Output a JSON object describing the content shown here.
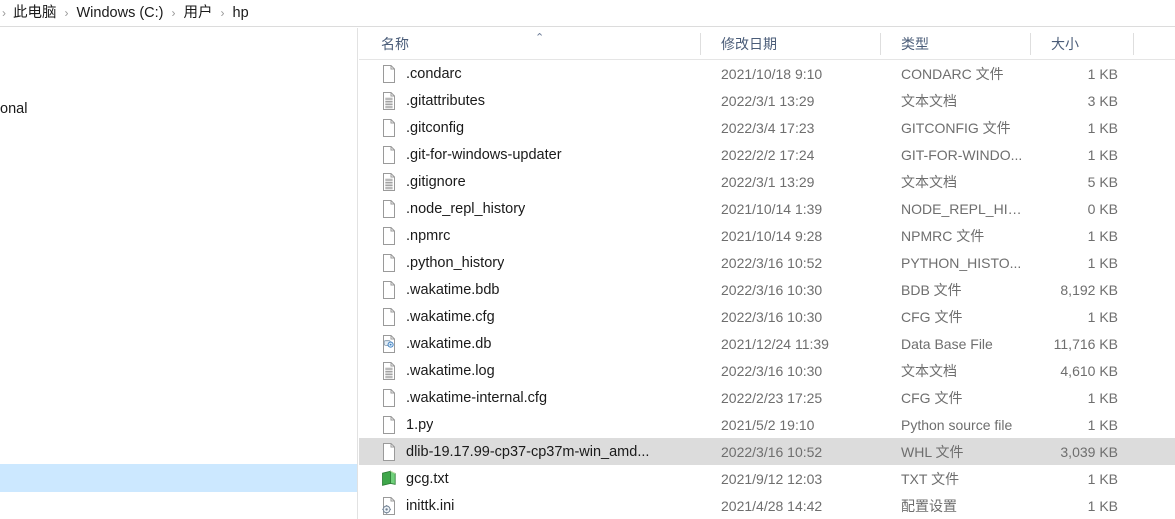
{
  "breadcrumb": {
    "items": [
      "此电脑",
      "Windows (C:)",
      "用户",
      "hp"
    ],
    "separator": "›"
  },
  "nav_pane": {
    "clipped_label": "onal",
    "selected_item_label": ""
  },
  "file_list": {
    "columns": {
      "name": "名称",
      "date": "修改日期",
      "type": "类型",
      "size": "大小"
    },
    "sort_indicator": "⌃",
    "rows": [
      {
        "icon": "blank-file-icon",
        "name": ".condarc",
        "date": "2021/10/18 9:10",
        "type": "CONDARC 文件",
        "size": "1 KB",
        "selected": false
      },
      {
        "icon": "text-file-icon",
        "name": ".gitattributes",
        "date": "2022/3/1 13:29",
        "type": "文本文档",
        "size": "3 KB",
        "selected": false
      },
      {
        "icon": "blank-file-icon",
        "name": ".gitconfig",
        "date": "2022/3/4 17:23",
        "type": "GITCONFIG 文件",
        "size": "1 KB",
        "selected": false
      },
      {
        "icon": "blank-file-icon",
        "name": ".git-for-windows-updater",
        "date": "2022/2/2 17:24",
        "type": "GIT-FOR-WINDO...",
        "size": "1 KB",
        "selected": false
      },
      {
        "icon": "text-file-icon",
        "name": ".gitignore",
        "date": "2022/3/1 13:29",
        "type": "文本文档",
        "size": "5 KB",
        "selected": false
      },
      {
        "icon": "blank-file-icon",
        "name": ".node_repl_history",
        "date": "2021/10/14 1:39",
        "type": "NODE_REPL_HIS...",
        "size": "0 KB",
        "selected": false
      },
      {
        "icon": "blank-file-icon",
        "name": ".npmrc",
        "date": "2021/10/14 9:28",
        "type": "NPMRC 文件",
        "size": "1 KB",
        "selected": false
      },
      {
        "icon": "blank-file-icon",
        "name": ".python_history",
        "date": "2022/3/16 10:52",
        "type": "PYTHON_HISTO...",
        "size": "1 KB",
        "selected": false
      },
      {
        "icon": "blank-file-icon",
        "name": ".wakatime.bdb",
        "date": "2022/3/16 10:30",
        "type": "BDB 文件",
        "size": "8,192 KB",
        "selected": false
      },
      {
        "icon": "blank-file-icon",
        "name": ".wakatime.cfg",
        "date": "2022/3/16 10:30",
        "type": "CFG 文件",
        "size": "1 KB",
        "selected": false
      },
      {
        "icon": "database-file-icon",
        "name": ".wakatime.db",
        "date": "2021/12/24 11:39",
        "type": "Data Base File",
        "size": "11,716 KB",
        "selected": false
      },
      {
        "icon": "text-file-icon",
        "name": ".wakatime.log",
        "date": "2022/3/16 10:30",
        "type": "文本文档",
        "size": "4,610 KB",
        "selected": false
      },
      {
        "icon": "blank-file-icon",
        "name": ".wakatime-internal.cfg",
        "date": "2022/2/23 17:25",
        "type": "CFG 文件",
        "size": "1 KB",
        "selected": false
      },
      {
        "icon": "blank-file-icon",
        "name": "1.py",
        "date": "2021/5/2 19:10",
        "type": "Python source file",
        "size": "1 KB",
        "selected": false
      },
      {
        "icon": "blank-file-icon",
        "name": "dlib-19.17.99-cp37-cp37m-win_amd...",
        "date": "2022/3/16 10:52",
        "type": "WHL 文件",
        "size": "3,039 KB",
        "selected": true
      },
      {
        "icon": "green-book-icon",
        "name": "gcg.txt",
        "date": "2021/9/12 12:03",
        "type": "TXT 文件",
        "size": "1 KB",
        "selected": false
      },
      {
        "icon": "config-file-icon",
        "name": "inittk.ini",
        "date": "2021/4/28 14:42",
        "type": "配置设置",
        "size": "1 KB",
        "selected": false
      }
    ]
  },
  "colors": {
    "header_text": "#4a5c78",
    "row_text": "#1a1a1a",
    "meta_text": "#6e6e6e",
    "selection_grey": "#dcdcdc",
    "selection_blue": "#cce8ff"
  }
}
